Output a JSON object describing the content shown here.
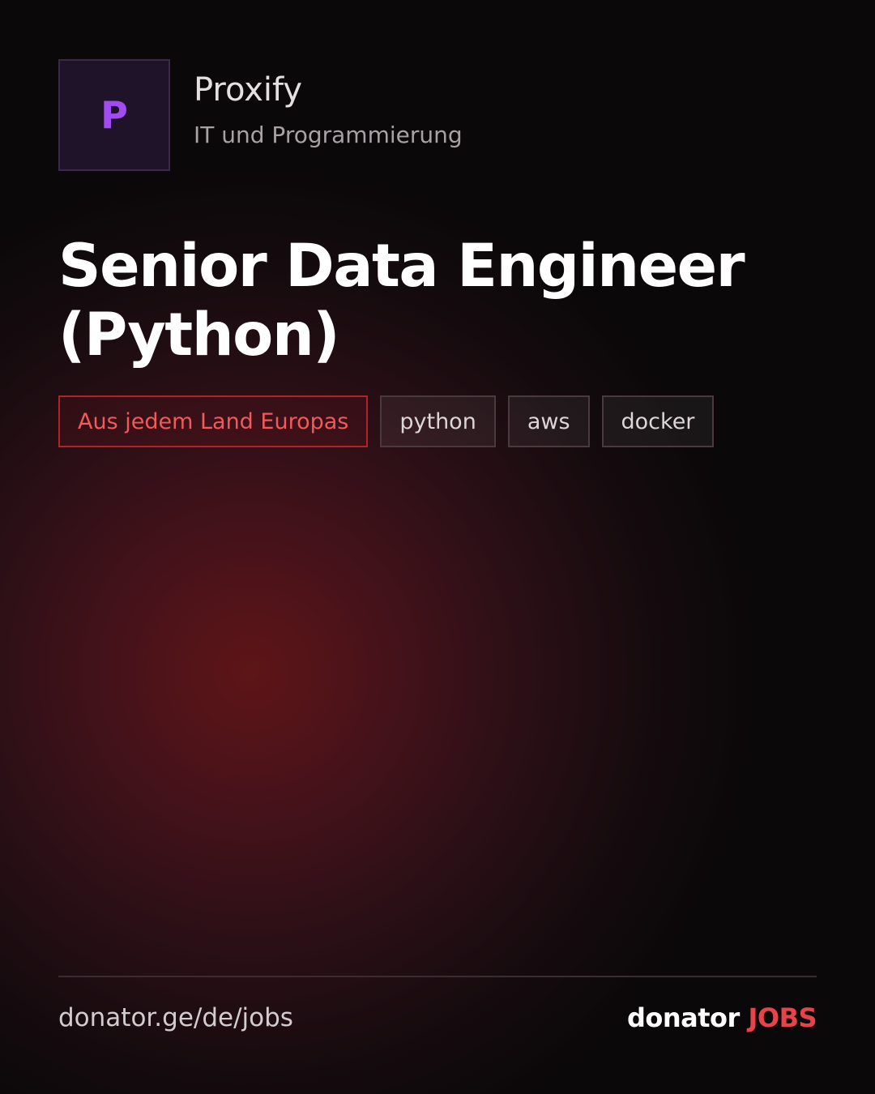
{
  "company": {
    "logo_letter": "P",
    "name": "Proxify",
    "category": "IT und Programmierung"
  },
  "job": {
    "title": "Senior Data Engineer (Python)"
  },
  "tags": {
    "location": "Aus jedem Land Europas",
    "skills": [
      "python",
      "aws",
      "docker"
    ]
  },
  "footer": {
    "url": "donator.ge/de/jobs",
    "brand_name": "donator",
    "brand_suffix": "JOBS"
  },
  "colors": {
    "accent": "#e8434a",
    "logo_letter": "#a24bf0",
    "location_tag_border": "#b02429",
    "background_glow": "#5e1517"
  },
  "icons": {
    "company_logo": "letter-monogram"
  }
}
